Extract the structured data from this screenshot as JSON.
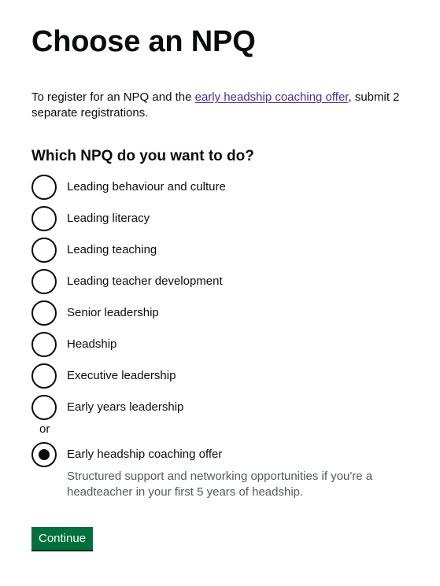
{
  "heading": "Choose an NPQ",
  "intro": {
    "before": "To register for an NPQ and the ",
    "link": "early headship coaching offer",
    "after": ", submit 2 separate registrations."
  },
  "question": "Which NPQ do you want to do?",
  "options": [
    {
      "label": "Leading behaviour and culture",
      "checked": false
    },
    {
      "label": "Leading literacy",
      "checked": false
    },
    {
      "label": "Leading teaching",
      "checked": false
    },
    {
      "label": "Leading teacher development",
      "checked": false
    },
    {
      "label": "Senior leadership",
      "checked": false
    },
    {
      "label": "Headship",
      "checked": false
    },
    {
      "label": "Executive leadership",
      "checked": false
    },
    {
      "label": "Early years leadership",
      "checked": false
    }
  ],
  "divider": "or",
  "coaching_option": {
    "label": "Early headship coaching offer",
    "hint": "Structured support and networking opportunities if you're a headteacher in your first 5 years of headship.",
    "checked": true
  },
  "continue_label": "Continue"
}
